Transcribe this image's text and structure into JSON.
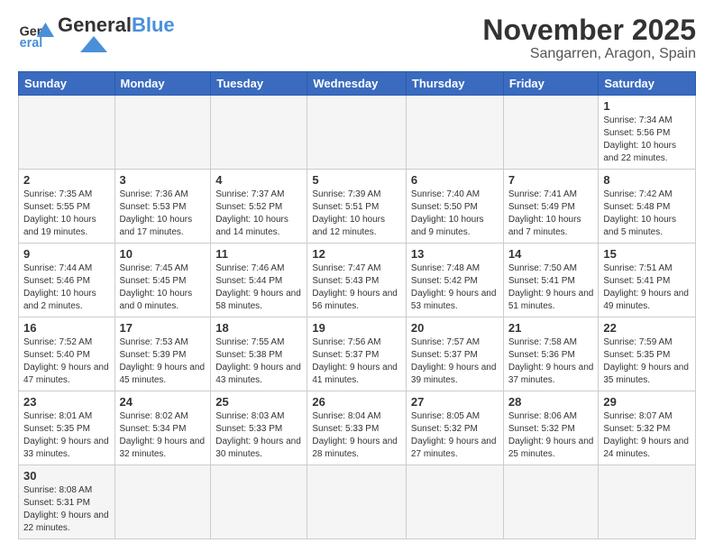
{
  "header": {
    "logo_general": "General",
    "logo_blue": "Blue",
    "title": "November 2025",
    "subtitle": "Sangarren, Aragon, Spain"
  },
  "weekdays": [
    "Sunday",
    "Monday",
    "Tuesday",
    "Wednesday",
    "Thursday",
    "Friday",
    "Saturday"
  ],
  "weeks": [
    [
      {
        "day": "",
        "info": ""
      },
      {
        "day": "",
        "info": ""
      },
      {
        "day": "",
        "info": ""
      },
      {
        "day": "",
        "info": ""
      },
      {
        "day": "",
        "info": ""
      },
      {
        "day": "",
        "info": ""
      },
      {
        "day": "1",
        "info": "Sunrise: 7:34 AM\nSunset: 5:56 PM\nDaylight: 10 hours and 22 minutes."
      }
    ],
    [
      {
        "day": "2",
        "info": "Sunrise: 7:35 AM\nSunset: 5:55 PM\nDaylight: 10 hours and 19 minutes."
      },
      {
        "day": "3",
        "info": "Sunrise: 7:36 AM\nSunset: 5:53 PM\nDaylight: 10 hours and 17 minutes."
      },
      {
        "day": "4",
        "info": "Sunrise: 7:37 AM\nSunset: 5:52 PM\nDaylight: 10 hours and 14 minutes."
      },
      {
        "day": "5",
        "info": "Sunrise: 7:39 AM\nSunset: 5:51 PM\nDaylight: 10 hours and 12 minutes."
      },
      {
        "day": "6",
        "info": "Sunrise: 7:40 AM\nSunset: 5:50 PM\nDaylight: 10 hours and 9 minutes."
      },
      {
        "day": "7",
        "info": "Sunrise: 7:41 AM\nSunset: 5:49 PM\nDaylight: 10 hours and 7 minutes."
      },
      {
        "day": "8",
        "info": "Sunrise: 7:42 AM\nSunset: 5:48 PM\nDaylight: 10 hours and 5 minutes."
      }
    ],
    [
      {
        "day": "9",
        "info": "Sunrise: 7:44 AM\nSunset: 5:46 PM\nDaylight: 10 hours and 2 minutes."
      },
      {
        "day": "10",
        "info": "Sunrise: 7:45 AM\nSunset: 5:45 PM\nDaylight: 10 hours and 0 minutes."
      },
      {
        "day": "11",
        "info": "Sunrise: 7:46 AM\nSunset: 5:44 PM\nDaylight: 9 hours and 58 minutes."
      },
      {
        "day": "12",
        "info": "Sunrise: 7:47 AM\nSunset: 5:43 PM\nDaylight: 9 hours and 56 minutes."
      },
      {
        "day": "13",
        "info": "Sunrise: 7:48 AM\nSunset: 5:42 PM\nDaylight: 9 hours and 53 minutes."
      },
      {
        "day": "14",
        "info": "Sunrise: 7:50 AM\nSunset: 5:41 PM\nDaylight: 9 hours and 51 minutes."
      },
      {
        "day": "15",
        "info": "Sunrise: 7:51 AM\nSunset: 5:41 PM\nDaylight: 9 hours and 49 minutes."
      }
    ],
    [
      {
        "day": "16",
        "info": "Sunrise: 7:52 AM\nSunset: 5:40 PM\nDaylight: 9 hours and 47 minutes."
      },
      {
        "day": "17",
        "info": "Sunrise: 7:53 AM\nSunset: 5:39 PM\nDaylight: 9 hours and 45 minutes."
      },
      {
        "day": "18",
        "info": "Sunrise: 7:55 AM\nSunset: 5:38 PM\nDaylight: 9 hours and 43 minutes."
      },
      {
        "day": "19",
        "info": "Sunrise: 7:56 AM\nSunset: 5:37 PM\nDaylight: 9 hours and 41 minutes."
      },
      {
        "day": "20",
        "info": "Sunrise: 7:57 AM\nSunset: 5:37 PM\nDaylight: 9 hours and 39 minutes."
      },
      {
        "day": "21",
        "info": "Sunrise: 7:58 AM\nSunset: 5:36 PM\nDaylight: 9 hours and 37 minutes."
      },
      {
        "day": "22",
        "info": "Sunrise: 7:59 AM\nSunset: 5:35 PM\nDaylight: 9 hours and 35 minutes."
      }
    ],
    [
      {
        "day": "23",
        "info": "Sunrise: 8:01 AM\nSunset: 5:35 PM\nDaylight: 9 hours and 33 minutes."
      },
      {
        "day": "24",
        "info": "Sunrise: 8:02 AM\nSunset: 5:34 PM\nDaylight: 9 hours and 32 minutes."
      },
      {
        "day": "25",
        "info": "Sunrise: 8:03 AM\nSunset: 5:33 PM\nDaylight: 9 hours and 30 minutes."
      },
      {
        "day": "26",
        "info": "Sunrise: 8:04 AM\nSunset: 5:33 PM\nDaylight: 9 hours and 28 minutes."
      },
      {
        "day": "27",
        "info": "Sunrise: 8:05 AM\nSunset: 5:32 PM\nDaylight: 9 hours and 27 minutes."
      },
      {
        "day": "28",
        "info": "Sunrise: 8:06 AM\nSunset: 5:32 PM\nDaylight: 9 hours and 25 minutes."
      },
      {
        "day": "29",
        "info": "Sunrise: 8:07 AM\nSunset: 5:32 PM\nDaylight: 9 hours and 24 minutes."
      }
    ],
    [
      {
        "day": "30",
        "info": "Sunrise: 8:08 AM\nSunset: 5:31 PM\nDaylight: 9 hours and 22 minutes."
      },
      {
        "day": "",
        "info": ""
      },
      {
        "day": "",
        "info": ""
      },
      {
        "day": "",
        "info": ""
      },
      {
        "day": "",
        "info": ""
      },
      {
        "day": "",
        "info": ""
      },
      {
        "day": "",
        "info": ""
      }
    ]
  ]
}
